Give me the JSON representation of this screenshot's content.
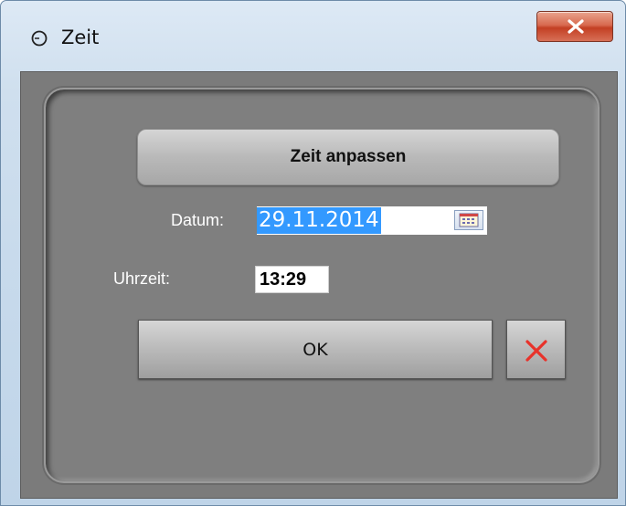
{
  "window": {
    "title": "Zeit",
    "title_icon": "clock-icon",
    "close_icon": "close-icon"
  },
  "dialog": {
    "heading": "Zeit anpassen",
    "date_label": "Datum:",
    "date_value": "29.11.2014",
    "calendar_icon": "calendar-icon",
    "time_label": "Uhrzeit:",
    "time_value": "13:29",
    "ok_label": "OK",
    "cancel_icon": "red-x-icon"
  },
  "colors": {
    "panel": "#7f7f7f",
    "selection": "#3399ff",
    "close_button": "#c9452a",
    "cancel_x": "#e8322a"
  }
}
